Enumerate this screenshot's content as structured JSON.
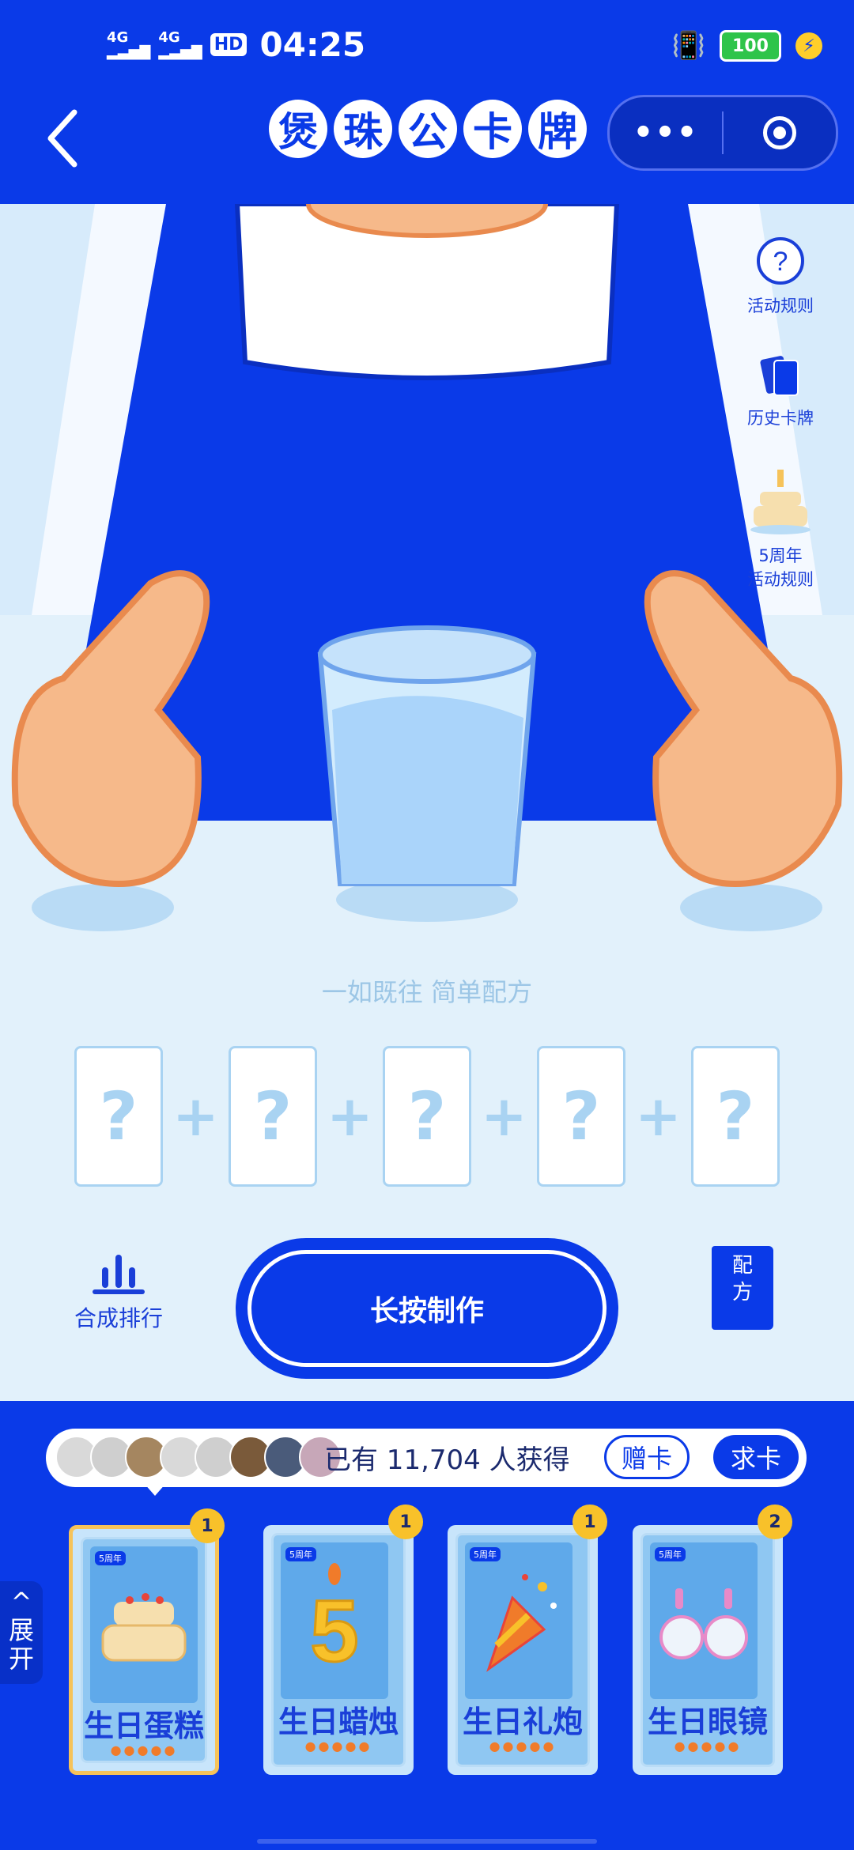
{
  "status": {
    "net1": "4G",
    "net2": "4G",
    "hd": "HD",
    "time": "04:25",
    "battery": "100"
  },
  "header": {
    "title_chars": [
      "煲",
      "珠",
      "公",
      "卡",
      "牌"
    ],
    "more": "•••"
  },
  "side": {
    "rules": "活动规则",
    "history": "历史卡牌",
    "anniv_line1": "5周年",
    "anniv_line2": "活动规则"
  },
  "main": {
    "slogan": "一如既往 简单配方",
    "slots": [
      "?",
      "?",
      "?",
      "?",
      "?"
    ],
    "plus": "+",
    "rank_label": "合成排行",
    "make_button": "长按制作",
    "recipe_line1": "配",
    "recipe_line2": "方"
  },
  "panel": {
    "owned_text": "已有 11,704 人获得",
    "gift_button": "赠卡",
    "ask_button": "求卡",
    "expand_line1": "^展",
    "expand_line2": "开",
    "cards": [
      {
        "name": "生日蛋糕",
        "count": "1",
        "tag": "5周年"
      },
      {
        "name": "生日蜡烛",
        "count": "1",
        "tag": "5周年"
      },
      {
        "name": "生日礼炮",
        "count": "1",
        "tag": "5周年"
      },
      {
        "name": "生日眼镜",
        "count": "2",
        "tag": "5周年"
      }
    ]
  },
  "colors": {
    "brand_blue": "#0a3ae8",
    "light_bg": "#e2f1fb",
    "skin": "#f6b98a",
    "badge": "#f8c12a"
  }
}
